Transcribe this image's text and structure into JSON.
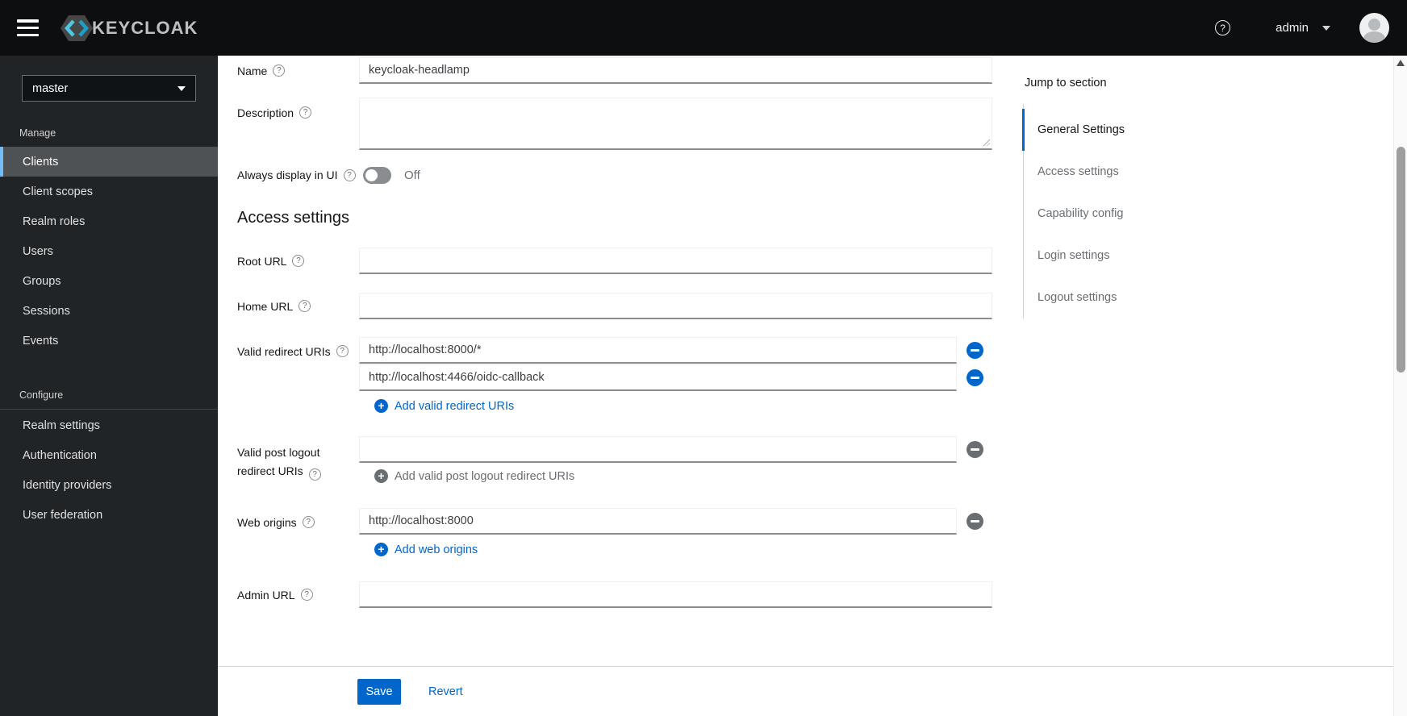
{
  "header": {
    "brand": "KEYCLOAK",
    "user_menu": {
      "label": "admin"
    }
  },
  "sidebar": {
    "realm_selector": {
      "value": "master"
    },
    "sections": [
      {
        "title": "Manage",
        "items": [
          {
            "label": "Clients",
            "active": true
          },
          {
            "label": "Client scopes"
          },
          {
            "label": "Realm roles"
          },
          {
            "label": "Users"
          },
          {
            "label": "Groups"
          },
          {
            "label": "Sessions"
          },
          {
            "label": "Events"
          }
        ]
      },
      {
        "title": "Configure",
        "items": [
          {
            "label": "Realm settings"
          },
          {
            "label": "Authentication"
          },
          {
            "label": "Identity providers"
          },
          {
            "label": "User federation"
          }
        ]
      }
    ]
  },
  "main": {
    "general": {
      "name": {
        "label": "Name",
        "value": "keycloak-headlamp"
      },
      "description": {
        "label": "Description",
        "value": ""
      },
      "always_display": {
        "label": "Always display in UI",
        "state_label": "Off"
      }
    },
    "access_heading": "Access settings",
    "access": {
      "root_url": {
        "label": "Root URL",
        "value": ""
      },
      "home_url": {
        "label": "Home URL",
        "value": ""
      },
      "redirect_uris": {
        "label": "Valid redirect URIs",
        "values": [
          "http://localhost:8000/*",
          "http://localhost:4466/oidc-callback"
        ],
        "add_label": "Add valid redirect URIs"
      },
      "post_logout_uris": {
        "label": "Valid post logout redirect URIs",
        "value": "",
        "add_label": "Add valid post logout redirect URIs"
      },
      "web_origins": {
        "label": "Web origins",
        "values": [
          "http://localhost:8000"
        ],
        "add_label": "Add web origins"
      },
      "admin_url": {
        "label": "Admin URL",
        "value": ""
      }
    }
  },
  "jump_panel": {
    "title": "Jump to section",
    "items": [
      {
        "label": "General Settings",
        "active": true
      },
      {
        "label": "Access settings"
      },
      {
        "label": "Capability config"
      },
      {
        "label": "Login settings"
      },
      {
        "label": "Logout settings"
      }
    ]
  },
  "action_bar": {
    "save_label": "Save",
    "revert_label": "Revert"
  },
  "colors": {
    "accent": "#0066cc",
    "sidebar_active_border": "#73bcf7",
    "disabled": "#6a6e73",
    "toggle_off_bg": "#8a8d90",
    "masthead_bg": "#0d0e10",
    "sidebar_bg": "#212427"
  }
}
